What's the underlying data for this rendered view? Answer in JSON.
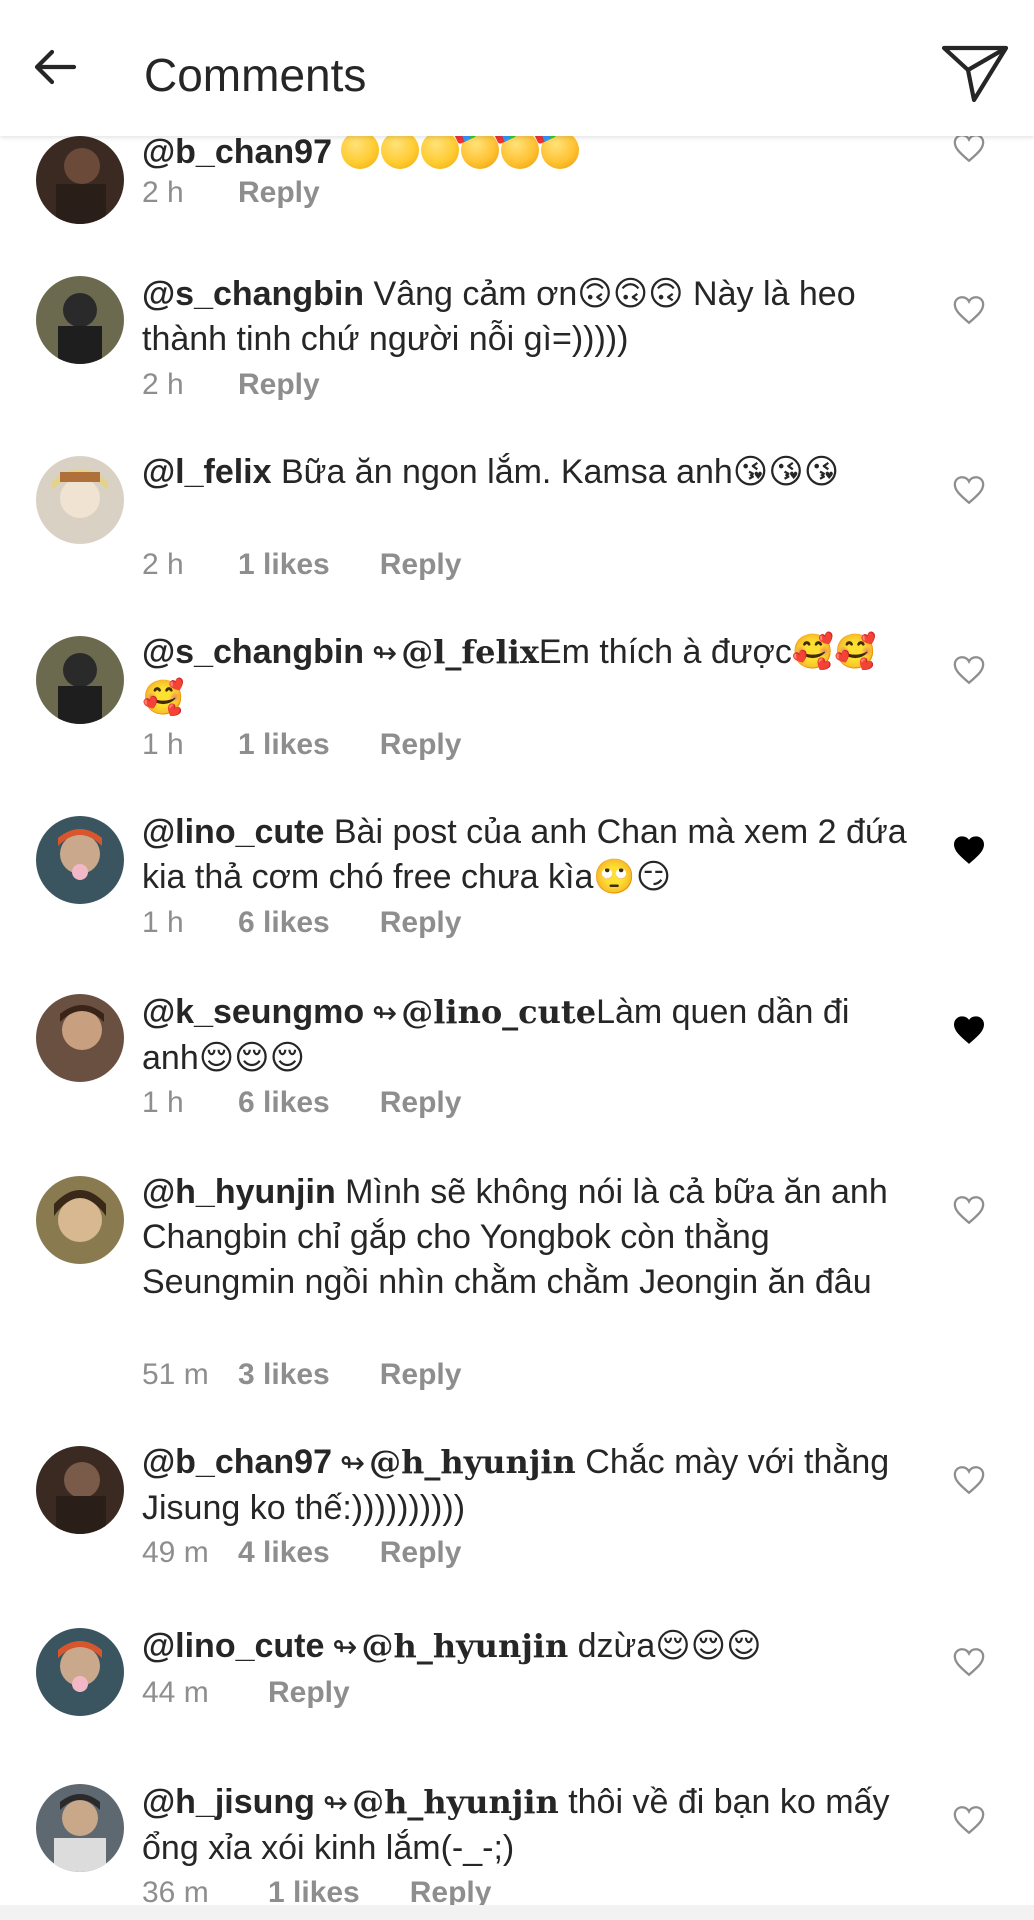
{
  "header": {
    "title": "Comments",
    "back_icon": "arrow-left-icon",
    "send_icon": "paper-plane-icon"
  },
  "colors": {
    "text": "#262626",
    "meta": "#8e8e8e",
    "heart_outline": "#8e8e8e",
    "heart_filled": "#000000",
    "emoji": "#ffcc33"
  },
  "comments": [
    {
      "username": "@b_chan97",
      "reply_to": "",
      "text": "",
      "emojis": [
        "yum",
        "yum",
        "smile",
        "party",
        "party",
        "party"
      ],
      "time": "2 h",
      "likes": "",
      "reply_label": "Reply",
      "liked": false
    },
    {
      "username": "@s_changbin",
      "reply_to": "",
      "text": "Vâng cảm ơn🙃🙃🙃 Này là heo thành tinh chứ người nỗi gì=)))))",
      "time": "2 h",
      "likes": "",
      "reply_label": "Reply",
      "liked": false
    },
    {
      "username": "@l_felix",
      "reply_to": "",
      "text": "Bữa ăn ngon lắm. Kamsa anh😘😘😘",
      "time": "2 h",
      "likes": "1 likes",
      "reply_label": "Reply",
      "liked": false
    },
    {
      "username": "@s_changbin",
      "reply_to": "@l_felix",
      "text": "Em thích à được🥰🥰🥰",
      "time": "1 h",
      "likes": "1 likes",
      "reply_label": "Reply",
      "liked": false
    },
    {
      "username": "@lino_cute",
      "reply_to": "",
      "text": "Bài post của anh Chan mà xem 2 đứa kia thả cơm chó free chưa kìa🙄😏",
      "time": "1 h",
      "likes": "6 likes",
      "reply_label": "Reply",
      "liked": true
    },
    {
      "username": "@k_seungmo",
      "reply_to": "@lino_cute",
      "text": "Làm quen dần đi anh😌😌😌",
      "time": "1 h",
      "likes": "6 likes",
      "reply_label": "Reply",
      "liked": true
    },
    {
      "username": "@h_hyunjin",
      "reply_to": "",
      "text": "Mình sẽ không nói là cả bữa ăn anh Changbin chỉ gắp cho Yongbok còn thằng Seungmin ngồi nhìn chằm chằm Jeongin ăn đâu",
      "time": "51 m",
      "likes": "3 likes",
      "reply_label": "Reply",
      "liked": false
    },
    {
      "username": "@b_chan97",
      "reply_to": "@h_hyunjin",
      "text": " Chắc mày với thằng Jisung ko thế:))))))))))",
      "time": "49 m",
      "likes": "4 likes",
      "reply_label": "Reply",
      "liked": false
    },
    {
      "username": "@lino_cute",
      "reply_to": "@h_hyunjin",
      "text": " dzừa😌😌😌",
      "time": "44 m",
      "likes": "",
      "reply_label": "Reply",
      "liked": false
    },
    {
      "username": "@h_jisung",
      "reply_to": "@h_hyunjin",
      "text": " thôi về đi bạn ko mấy ổng xỉa xói kinh lắm(-_-;)",
      "time": "36 m",
      "likes": "1 likes",
      "reply_label": "Reply",
      "liked": false
    }
  ]
}
